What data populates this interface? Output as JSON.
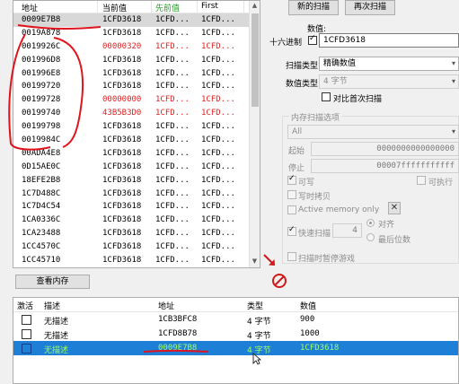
{
  "results": {
    "headers": {
      "address": "地址",
      "current": "当前值",
      "previous": "先前值",
      "first": "First"
    },
    "rows": [
      {
        "address": "0009E7B8",
        "current": "1CFD3618",
        "previous": "1CFD...",
        "first": "1CFD...",
        "changed": false,
        "selected": true
      },
      {
        "address": "0019A878",
        "current": "1CFD3618",
        "previous": "1CFD...",
        "first": "1CFD...",
        "changed": false
      },
      {
        "address": "0019926C",
        "current": "00000320",
        "previous": "1CFD...",
        "first": "1CFD...",
        "changed": true
      },
      {
        "address": "001996D8",
        "current": "1CFD3618",
        "previous": "1CFD...",
        "first": "1CFD...",
        "changed": false
      },
      {
        "address": "001996E8",
        "current": "1CFD3618",
        "previous": "1CFD...",
        "first": "1CFD...",
        "changed": false
      },
      {
        "address": "00199720",
        "current": "1CFD3618",
        "previous": "1CFD...",
        "first": "1CFD...",
        "changed": false
      },
      {
        "address": "00199728",
        "current": "00000000",
        "previous": "1CFD...",
        "first": "1CFD...",
        "changed": true
      },
      {
        "address": "00199740",
        "current": "43B5B3D0",
        "previous": "1CFD...",
        "first": "1CFD...",
        "changed": true
      },
      {
        "address": "00199798",
        "current": "1CFD3618",
        "previous": "1CFD...",
        "first": "1CFD...",
        "changed": false
      },
      {
        "address": "0019984C",
        "current": "1CFD3618",
        "previous": "1CFD...",
        "first": "1CFD...",
        "changed": false
      },
      {
        "address": "00ADA4E8",
        "current": "1CFD3618",
        "previous": "1CFD...",
        "first": "1CFD...",
        "changed": false
      },
      {
        "address": "0D15AE0C",
        "current": "1CFD3618",
        "previous": "1CFD...",
        "first": "1CFD...",
        "changed": false
      },
      {
        "address": "18EFE2B8",
        "current": "1CFD3618",
        "previous": "1CFD...",
        "first": "1CFD...",
        "changed": false
      },
      {
        "address": "1C7D488C",
        "current": "1CFD3618",
        "previous": "1CFD...",
        "first": "1CFD...",
        "changed": false
      },
      {
        "address": "1C7D4C54",
        "current": "1CFD3618",
        "previous": "1CFD...",
        "first": "1CFD...",
        "changed": false
      },
      {
        "address": "1CA0336C",
        "current": "1CFD3618",
        "previous": "1CFD...",
        "first": "1CFD...",
        "changed": false
      },
      {
        "address": "1CA23488",
        "current": "1CFD3618",
        "previous": "1CFD...",
        "first": "1CFD...",
        "changed": false
      },
      {
        "address": "1CC4570C",
        "current": "1CFD3618",
        "previous": "1CFD...",
        "first": "1CFD...",
        "changed": false
      },
      {
        "address": "1CC45710",
        "current": "1CFD3618",
        "previous": "1CFD...",
        "first": "1CFD...",
        "changed": false
      }
    ]
  },
  "scan": {
    "new_scan": "新的扫描",
    "next_scan": "再次扫描",
    "value_label": "数值:",
    "hex_label": "十六进制",
    "hex_checked": true,
    "value": "1CFD3618",
    "scan_type_label": "扫描类型",
    "scan_type": "精确数值",
    "value_type_label": "数值类型",
    "value_type": "4 字节",
    "compare_first": "对比首次扫描",
    "mem_options_label": "内存扫描选项",
    "region": "All",
    "start_label": "起始",
    "start_value": "0000000000000000",
    "stop_label": "停止",
    "stop_value": "00007fffffffffff",
    "writable": "可写",
    "executable": "可执行",
    "copy_on_write": "写时拷贝",
    "active_memory": "Active memory only",
    "fast_scan": "快速扫描",
    "fast_scan_value": "4",
    "align": "对齐",
    "last_digits": "最后位数",
    "pause_game": "扫描时暂停游戏"
  },
  "view_memory": "查看内存",
  "addrlist": {
    "headers": {
      "active": "激活",
      "desc": "描述",
      "address": "地址",
      "type": "类型",
      "value": "数值"
    },
    "rows": [
      {
        "desc": "无描述",
        "address": "1CB3BFC8",
        "type": "4 字节",
        "value": "900",
        "selected": false
      },
      {
        "desc": "无描述",
        "address": "1CFD8B78",
        "type": "4 字节",
        "value": "1000",
        "selected": false
      },
      {
        "desc": "无描述",
        "address": "0009E7B8",
        "type": "4 字节",
        "value": "1CFD3618",
        "selected": true
      }
    ]
  },
  "colors": {
    "highlight": "#1e7fd6",
    "changed": "#e02020",
    "annotation": "#e0141e"
  },
  "icons": {
    "arrow": "red-diagonal-arrow-icon",
    "stop": "no-entry-icon"
  }
}
